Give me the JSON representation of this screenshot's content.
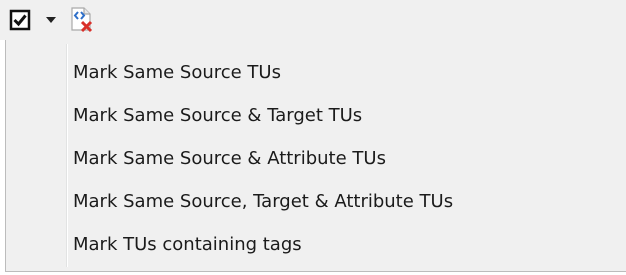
{
  "toolbar": {
    "checkbox_icon": "checked-checkbox-icon",
    "dropdown_icon": "dropdown-arrow-icon",
    "tag_delete_icon": "tag-delete-icon"
  },
  "menu": {
    "items": [
      {
        "label": "Mark Same Source TUs"
      },
      {
        "label": "Mark Same Source & Target TUs"
      },
      {
        "label": "Mark Same Source & Attribute TUs"
      },
      {
        "label": "Mark Same Source, Target & Attribute TUs"
      },
      {
        "label": "Mark TUs containing tags"
      }
    ]
  },
  "colors": {
    "toolbar_bg": "#f0f0f0",
    "menu_bg": "#f0f0f0",
    "menu_border": "#bcbcbc",
    "tag_icon_blue": "#2e6fc9",
    "delete_red": "#d9302a"
  }
}
